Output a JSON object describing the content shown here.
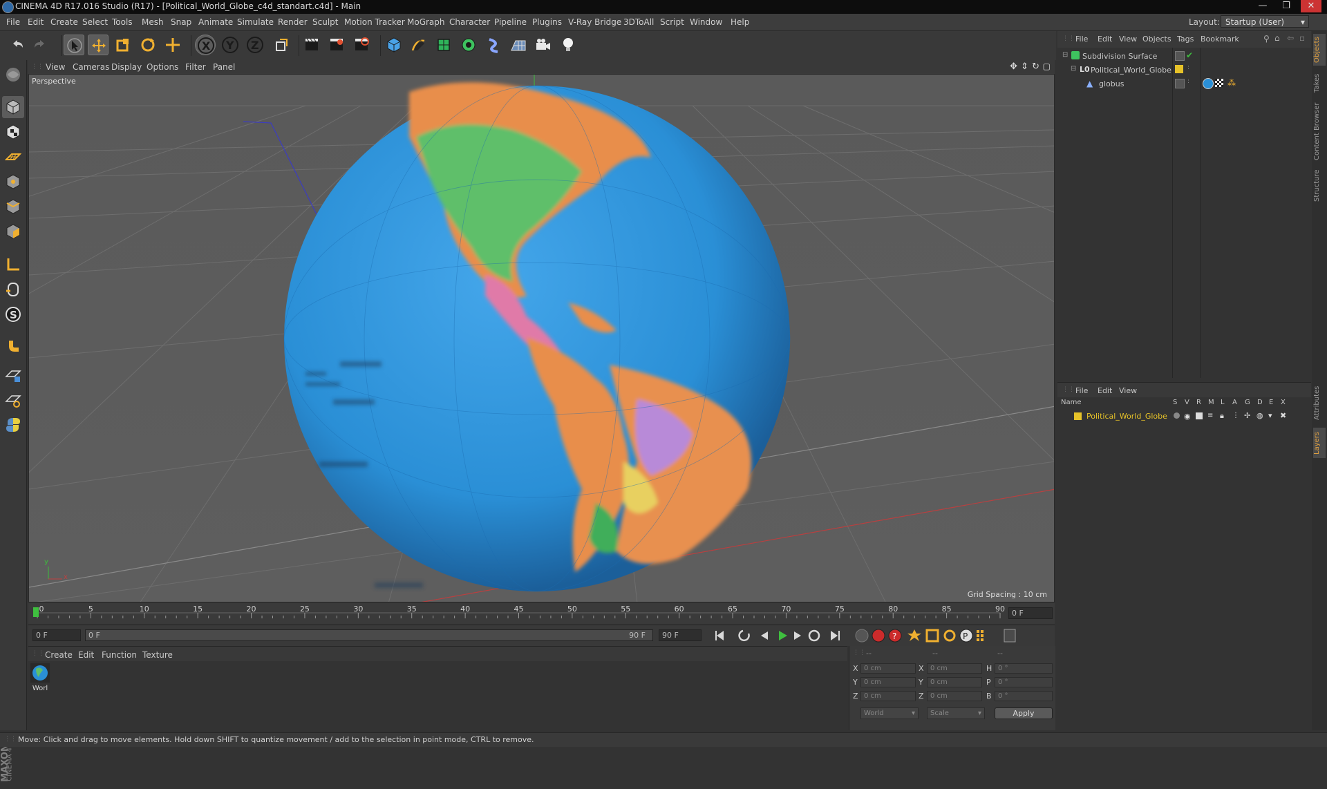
{
  "window": {
    "title": "CINEMA 4D R17.016 Studio (R17) - [Political_World_Globe_c4d_standart.c4d] - Main",
    "controls": [
      "—",
      "❐",
      "✕"
    ]
  },
  "menu": {
    "items": [
      "File",
      "Edit",
      "Create",
      "Select",
      "Tools",
      "Mesh",
      "Snap",
      "Animate",
      "Simulate",
      "Render",
      "Sculpt",
      "Motion Tracker",
      "MoGraph",
      "Character",
      "Pipeline",
      "Plugins",
      "V-Ray Bridge",
      "3DToAll",
      "Script",
      "Window",
      "Help"
    ],
    "layout_label": "Layout:",
    "layout_value": "Startup (User)"
  },
  "toolbar": {
    "icons": [
      "undo-icon",
      "redo-icon",
      "select-arrow-icon",
      "move-icon",
      "scale-icon",
      "rotate-icon",
      "live-select-icon",
      "axis-x-icon",
      "axis-y-icon",
      "axis-z-icon",
      "coordinate-system-icon",
      "render-view-icon",
      "render-picture-viewer-icon",
      "render-settings-icon",
      "cube-icon",
      "pen-spline-icon",
      "subdivision-icon",
      "cloner-icon",
      "deformer-icon",
      "floor-icon",
      "camera-icon",
      "light-icon"
    ],
    "axis_labels": [
      "X",
      "Y",
      "Z"
    ]
  },
  "viewport": {
    "menus": [
      "View",
      "Cameras",
      "Display",
      "Options",
      "Filter",
      "Panel"
    ],
    "label": "Perspective",
    "grid_spacing": "Grid Spacing : 10 cm",
    "axis_y": "y",
    "axis_x": "x"
  },
  "timeline": {
    "ticks": [
      "0",
      "5",
      "10",
      "15",
      "20",
      "25",
      "30",
      "35",
      "40",
      "45",
      "50",
      "55",
      "60",
      "65",
      "70",
      "75",
      "80",
      "85",
      "90"
    ],
    "current_frame": "0 F",
    "start_field": "0 F",
    "range_start": "0 F",
    "range_end": "90 F",
    "end_field": "90 F"
  },
  "material_manager": {
    "menus": [
      "Create",
      "Edit",
      "Function",
      "Texture"
    ],
    "material_name": "Worl"
  },
  "coordinates": {
    "header": [
      "--",
      "--",
      "--"
    ],
    "rows": [
      {
        "a": "X",
        "av": "0 cm",
        "b": "X",
        "bv": "0 cm",
        "c": "H",
        "cv": "0 °"
      },
      {
        "a": "Y",
        "av": "0 cm",
        "b": "Y",
        "bv": "0 cm",
        "c": "P",
        "cv": "0 °"
      },
      {
        "a": "Z",
        "av": "0 cm",
        "b": "Z",
        "bv": "0 cm",
        "c": "B",
        "cv": "0 °"
      }
    ],
    "mode_world": "World",
    "mode_scale": "Scale",
    "apply": "Apply"
  },
  "object_manager": {
    "menus": [
      "File",
      "Edit",
      "View",
      "Objects",
      "Tags",
      "Bookmark"
    ],
    "objects": [
      {
        "name": "Subdivision Surface",
        "color": "#c8c8c8"
      },
      {
        "name": "Political_World_Globe",
        "color": "#c8c8c8"
      },
      {
        "name": "globus",
        "color": "#c8c8c8"
      }
    ]
  },
  "layer_manager": {
    "menus": [
      "File",
      "Edit",
      "View"
    ],
    "columns": [
      "Name",
      "S",
      "V",
      "R",
      "M",
      "L",
      "A",
      "G",
      "D",
      "E",
      "X"
    ],
    "layers": [
      {
        "name": "Political_World_Globe",
        "color": "#e6c229"
      }
    ]
  },
  "side_tabs": [
    "Objects",
    "Takes",
    "Content Browser",
    "Structure",
    "Attributes",
    "Layers"
  ],
  "status": "Move: Click and drag to move elements. Hold down SHIFT to quantize movement / add to the selection in point mode, CTRL to remove.",
  "brand": {
    "maxon": "MAXON",
    "c4d": "CINEMA 4D"
  },
  "colors": {
    "accent": "#e6c229",
    "globe_ocean": "#2a8fd6",
    "timeline_green": "#3fbf3f"
  }
}
